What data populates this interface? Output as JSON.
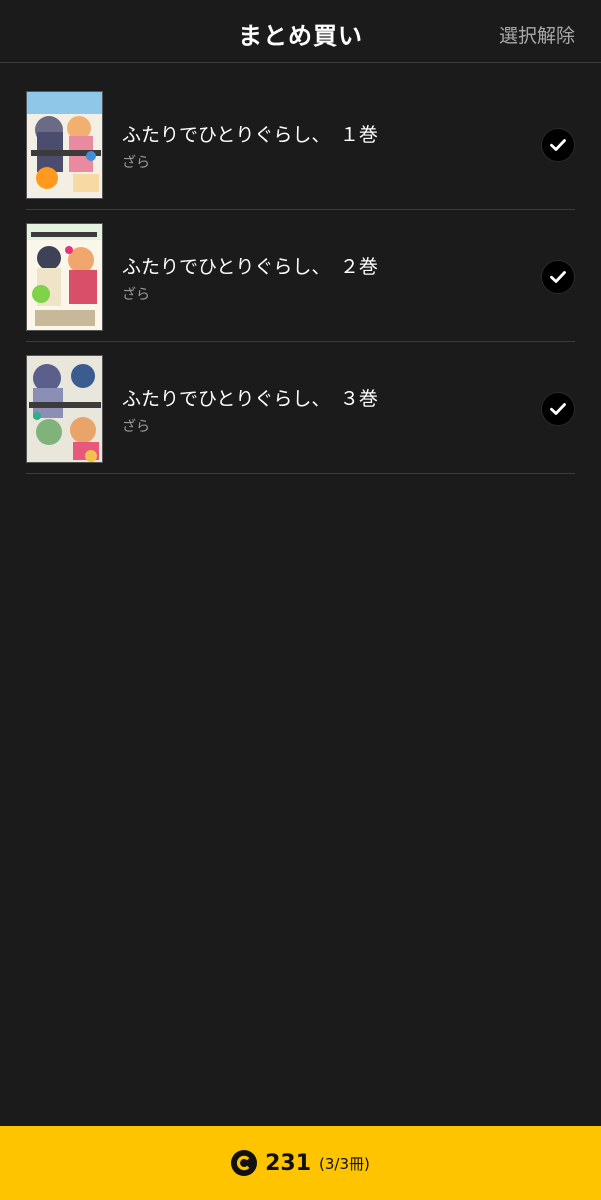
{
  "header": {
    "title": "まとめ買い",
    "deselect_label": "選択解除"
  },
  "items": [
    {
      "title": "ふたりでひとりぐらし、　１巻",
      "author": "ざら",
      "checked": true
    },
    {
      "title": "ふたりでひとりぐらし、　２巻",
      "author": "ざら",
      "checked": true
    },
    {
      "title": "ふたりでひとりぐらし、　３巻",
      "author": "ざら",
      "checked": true
    }
  ],
  "footer": {
    "coin_icon": "coin-icon",
    "price": "231",
    "count": "(3/3冊)"
  },
  "colors": {
    "background": "#1b1b1b",
    "accent": "#ffc400",
    "divider": "#3a3a3a"
  }
}
